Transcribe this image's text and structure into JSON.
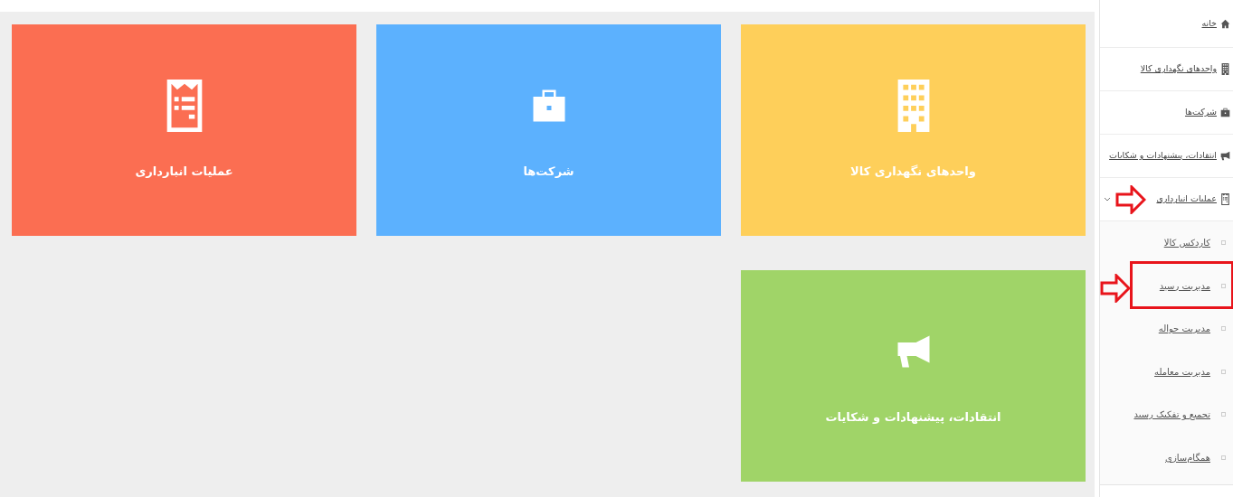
{
  "sidebar": {
    "items": [
      {
        "label": "خانه"
      },
      {
        "label": "واحدهای نگهداری کالا"
      },
      {
        "label": "شرکت‌ها"
      },
      {
        "label": "انتقادات، پیشنهادات و شکایات"
      },
      {
        "label": "عملیات انبارداری",
        "expanded": true,
        "pointed": true,
        "children": [
          {
            "label": "کاردکس کالا",
            "highlighted": false
          },
          {
            "label": "مدیریت رسید",
            "highlighted": true
          },
          {
            "label": "مدیریت حواله",
            "highlighted": false
          },
          {
            "label": "مدیریت معامله",
            "highlighted": false
          },
          {
            "label": "تجمیع و تفکیک رسید",
            "highlighted": false
          },
          {
            "label": "همگام‌سازی",
            "highlighted": false
          }
        ]
      }
    ]
  },
  "tiles": [
    {
      "label": "واحدهای نگهداری کالا",
      "color": "#fecf5a"
    },
    {
      "label": "شرکت‌ها",
      "color": "#5cb1fe"
    },
    {
      "label": "عملیات انبارداری",
      "color": "#fb6e52"
    },
    {
      "label": "انتقادات، پیشنهادات و شکایات",
      "color": "#a0d468"
    }
  ]
}
